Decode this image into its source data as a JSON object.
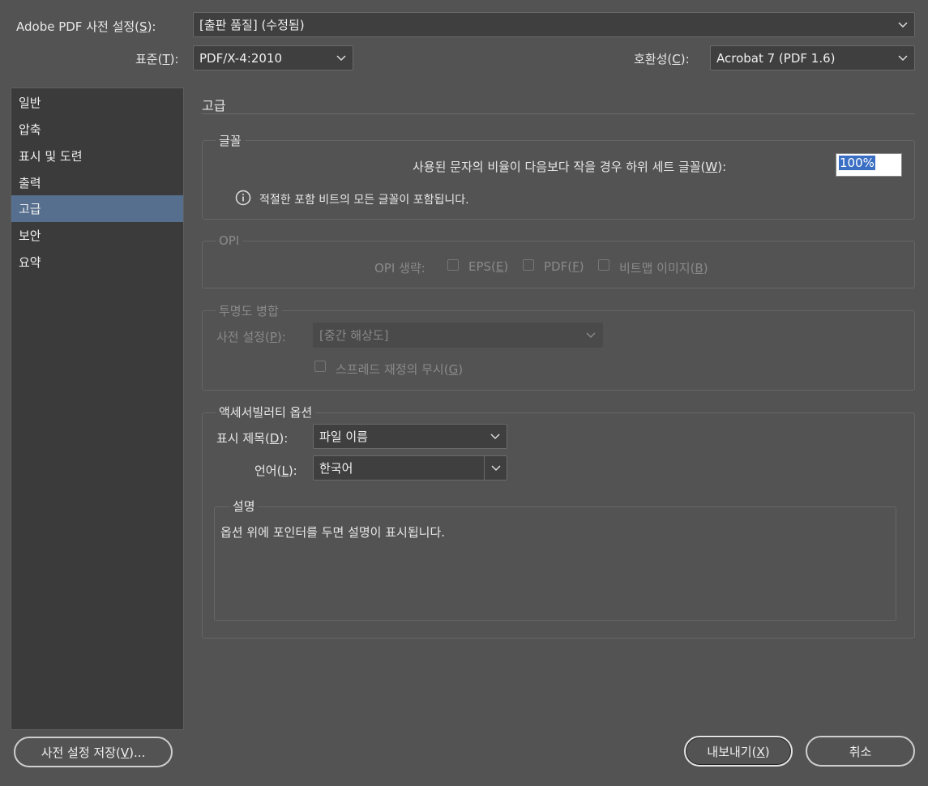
{
  "top": {
    "preset_label": "Adobe PDF 사전 설정(",
    "preset_key": "S",
    "preset_suffix": "):",
    "preset_value": "[출판 품질] (수정됨)",
    "standard_label": "표준(",
    "standard_key": "T",
    "standard_suffix": "):",
    "standard_value": "PDF/X-4:2010",
    "compat_label": "호환성(",
    "compat_key": "C",
    "compat_suffix": "):",
    "compat_value": "Acrobat 7 (PDF 1.6)"
  },
  "sidebar": {
    "items": [
      {
        "label": "일반"
      },
      {
        "label": "압축"
      },
      {
        "label": "표시 및 도련"
      },
      {
        "label": "출력"
      },
      {
        "label": "고급"
      },
      {
        "label": "보안"
      },
      {
        "label": "요약"
      }
    ],
    "active_index": 4
  },
  "section_title": "고급",
  "fonts": {
    "title": "글꼴",
    "subset_label": "사용된 문자의 비율이 다음보다 작을 경우 하위 세트 글꼴(",
    "subset_key": "W",
    "subset_suffix": "):",
    "subset_value": "100%",
    "info_text": "적절한 포함 비트의 모든 글꼴이 포함됩니다."
  },
  "opi": {
    "title": "OPI",
    "omit_label": "OPI 생략:",
    "eps_label": "EPS(",
    "eps_key": "E",
    "pdf_label": "PDF(",
    "pdf_key": "F",
    "bitmap_label": "비트맵 이미지(",
    "bitmap_key": "B",
    "close": ")"
  },
  "transparency": {
    "title": "투명도 병합",
    "preset_label": "사전 설정(",
    "preset_key": "P",
    "preset_suffix": "):",
    "preset_value": "[중간 해상도]",
    "spread_label": "스프레드 재정의 무시(",
    "spread_key": "G",
    "close": ")"
  },
  "accessibility": {
    "title": "액세서빌러티 옵션",
    "display_title_label": "표시 제목(",
    "display_title_key": "D",
    "display_title_suffix": "):",
    "display_title_value": "파일 이름",
    "language_label": "언어(",
    "language_key": "L",
    "language_suffix": "):",
    "language_value": "한국어"
  },
  "description": {
    "title": "설명",
    "text": "옵션 위에 포인터를 두면 설명이 표시됩니다."
  },
  "buttons": {
    "save_preset": "사전 설정 저장(",
    "save_preset_key": "V",
    "save_preset_suffix": ")...",
    "export": "내보내기(",
    "export_key": "X",
    "export_suffix": ")",
    "cancel": "취소"
  },
  "colors": {
    "background": "#535353",
    "sidebar_active": "#566f8e",
    "selection": "#3a6fc4"
  }
}
